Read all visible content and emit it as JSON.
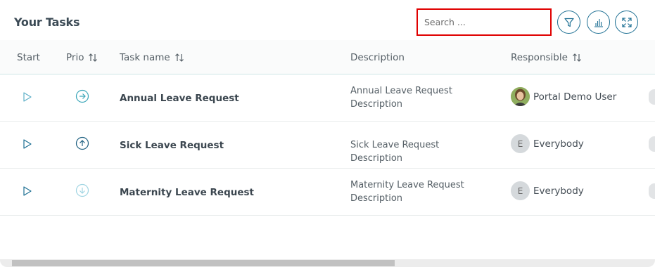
{
  "header": {
    "title": "Your Tasks",
    "search_placeholder": "Search ...",
    "icons": [
      "filter-icon",
      "chart-icon",
      "expand-icon"
    ]
  },
  "columns": {
    "start": "Start",
    "prio": "Prio",
    "task_name": "Task name",
    "description": "Description",
    "responsible": "Responsible"
  },
  "rows": [
    {
      "task_name": "Annual Leave Request",
      "description": "Annual Leave Request Description",
      "priority": "normal",
      "responsible": "Portal Demo User",
      "avatar": "photo"
    },
    {
      "task_name": "Sick Leave Request",
      "description": "Sick Leave Request Description",
      "priority": "high",
      "responsible": "Everybody",
      "avatar": "E"
    },
    {
      "task_name": "Maternity Leave Request",
      "description": "Maternity Leave Request Description",
      "priority": "low",
      "responsible": "Everybody",
      "avatar": "E"
    }
  ],
  "colors": {
    "accent": "#1d6f93",
    "search_border": "#e00000",
    "prio_normal": "#3aa6b9",
    "prio_high": "#1d5f80",
    "prio_low": "#9fd4e2"
  }
}
